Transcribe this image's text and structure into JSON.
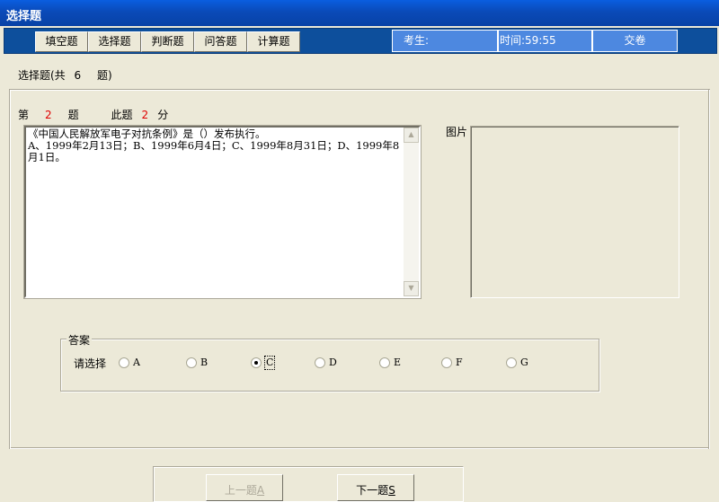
{
  "window": {
    "title": "选择题"
  },
  "toolbar": {
    "tabs": [
      {
        "label": "填空题"
      },
      {
        "label": "选择题"
      },
      {
        "label": "判断题"
      },
      {
        "label": "问答题"
      },
      {
        "label": "计算题"
      }
    ],
    "examinee_label": "考生:",
    "timer": "时间:59:55",
    "submit_label": "交卷"
  },
  "section": {
    "prefix": "选择题(共",
    "count": "6",
    "suffix": "题)"
  },
  "question": {
    "number_prefix": "第",
    "number": "2",
    "number_suffix": "题",
    "score_prefix": "此题",
    "score": "2",
    "score_suffix": "分",
    "text": "《中国人民解放军电子对抗条例》是（）发布执行。\nA、1999年2月13日；B、1999年6月4日；C、1999年8月31日；D、1999年8月1日。"
  },
  "image_label": "图片",
  "answer": {
    "group_label": "答案",
    "prompt": "请选择",
    "options": [
      {
        "label": "A",
        "checked": false
      },
      {
        "label": "B",
        "checked": false
      },
      {
        "label": "C",
        "checked": true
      },
      {
        "label": "D",
        "checked": false
      },
      {
        "label": "E",
        "checked": false
      },
      {
        "label": "F",
        "checked": false
      },
      {
        "label": "G",
        "checked": false
      }
    ]
  },
  "nav": {
    "prev_label": "上一题",
    "prev_key": "A",
    "next_label": "下一题",
    "next_key": "S"
  }
}
